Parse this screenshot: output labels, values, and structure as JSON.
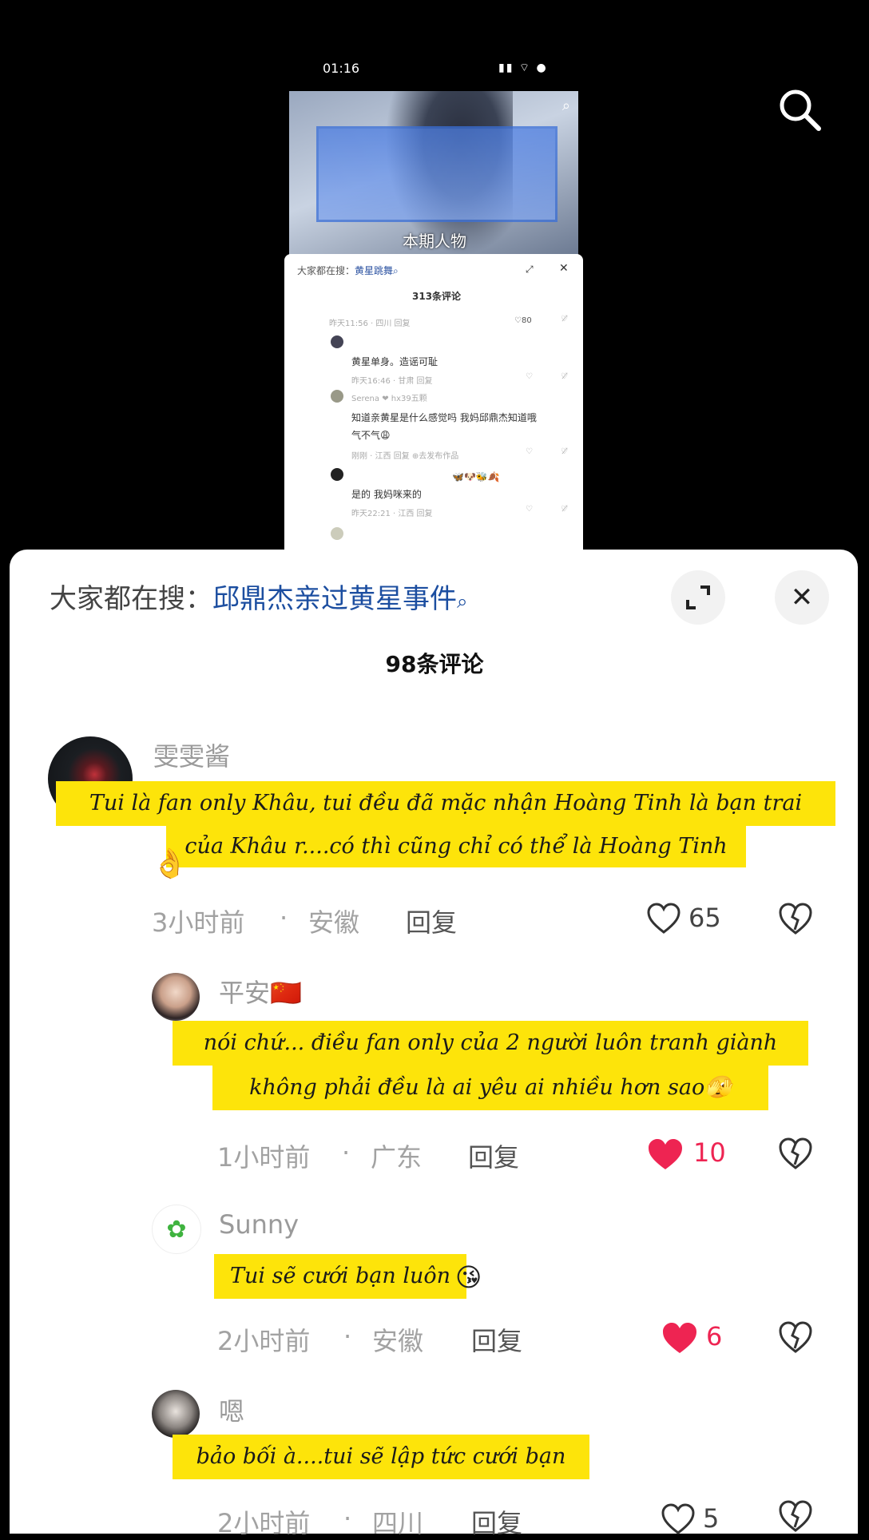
{
  "status": {
    "time": "01:16",
    "icons": "▮▮ ⌔ ●"
  },
  "thumbnail": {
    "caption": "本期人物"
  },
  "mini_panel": {
    "search_label": "大家都在搜：",
    "search_term": "黄星跳舞",
    "count": "313条评论",
    "rows": [
      {
        "meta": "昨天11:56 · 四川      回复",
        "likes": "♡80"
      },
      {
        "text": "黄星单身。造谣可耻"
      },
      {
        "meta": "昨天16:46 · 甘肃      回复"
      },
      {
        "meta": "Serena   ❤  hx39五颗"
      },
      {
        "text": "知道亲黄星是什么感觉吗 我妈邱鼎杰知道哦"
      },
      {
        "text": "气不气😩"
      },
      {
        "meta": "刚刚 · 江西      回复   ⊕去发布作品"
      },
      {
        "text": "🦋🐶🐝🍂"
      },
      {
        "text": "是的  我妈咪来的"
      },
      {
        "meta": "昨天22:21 · 江西      回复"
      }
    ]
  },
  "sheet": {
    "search_label": "大家都在搜：",
    "search_term": "邱鼎杰亲过黄星事件",
    "count": "98条评论",
    "comments": [
      {
        "username": "雯雯酱",
        "caption_line1": "Tui là fan only Khâu, tui đều đã mặc nhận Hoàng Tinh là bạn trai",
        "caption_line2": "của Khâu r....có thì cũng chỉ có thể là Hoàng Tinh",
        "time": "3小时前",
        "location": "安徽",
        "reply": "回复",
        "likes": "65",
        "liked": false
      },
      {
        "username": "平安🇨🇳",
        "caption_line1": "nói chứ... điều fan only của 2 người luôn tranh giành",
        "caption_line2": "không phải đều là ai yêu ai nhiều hơn sao🫣",
        "time": "1小时前",
        "location": "广东",
        "reply": "回复",
        "likes": "10",
        "liked": true
      },
      {
        "username": "Sunny",
        "caption_line1": "Tui sẽ cưới bạn luôn",
        "time": "2小时前",
        "location": "安徽",
        "reply": "回复",
        "likes": "6",
        "liked": true
      },
      {
        "username": "嗯",
        "caption_line1": "bảo bối à....tui sẽ lập tức cưới bạn",
        "time": "2小时前",
        "location": "四川",
        "reply": "回复",
        "likes": "5",
        "liked": false
      }
    ]
  },
  "colors": {
    "accent_like": "#ee2452",
    "caption_bg": "#fde40a",
    "search_highlight": "#1c4ea0"
  }
}
